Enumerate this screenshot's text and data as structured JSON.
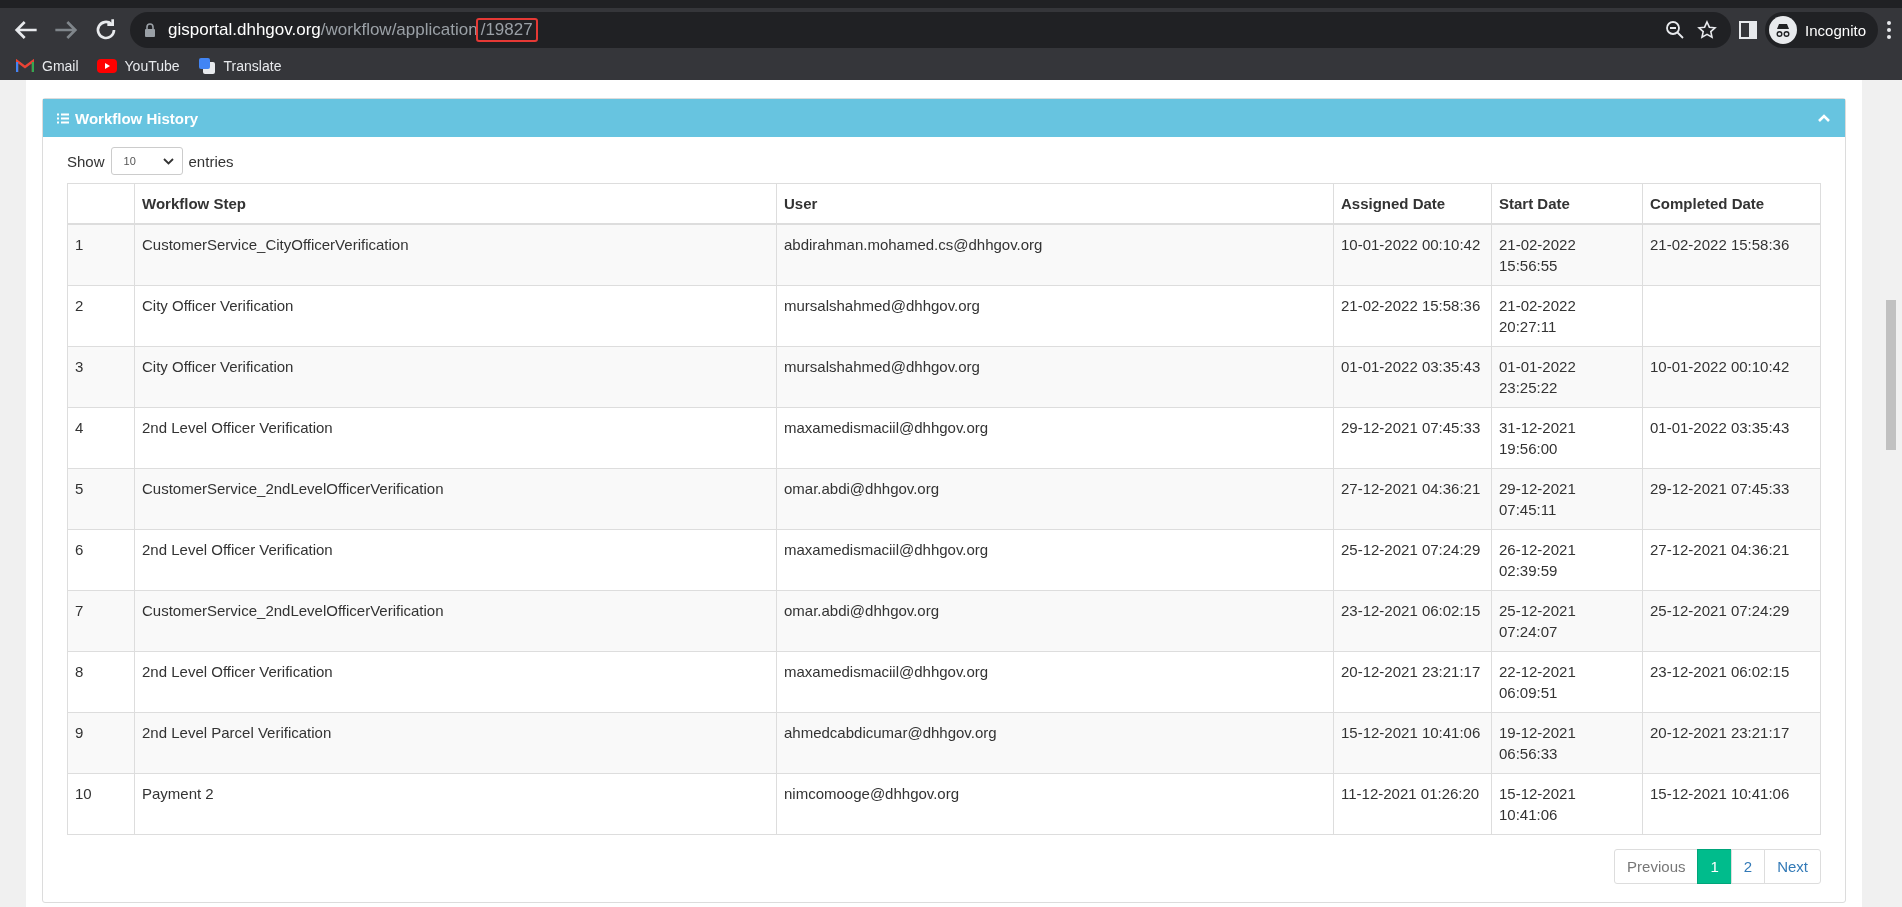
{
  "browser": {
    "address_bar": {
      "host": "gisportal.dhhgov.org",
      "path": "/workflow/application",
      "highlighted": "/19827"
    },
    "profile": "Incognito",
    "bookmarks": [
      {
        "label": "Gmail",
        "kind": "gmail"
      },
      {
        "label": "YouTube",
        "kind": "youtube"
      },
      {
        "label": "Translate",
        "kind": "translate"
      }
    ]
  },
  "panel": {
    "title": "Workflow History",
    "expanded": true,
    "length": {
      "label_before": "Show",
      "value": "10",
      "label_after": "entries"
    },
    "table": {
      "columns": [
        "",
        "Workflow Step",
        "User",
        "Assigned Date",
        "Start Date",
        "Completed Date"
      ],
      "rows": [
        [
          "1",
          "CustomerService_CityOfficerVerification",
          "abdirahman.mohamed.cs@dhhgov.org",
          "10-01-2022 00:10:42",
          "21-02-2022 15:56:55",
          "21-02-2022 15:58:36"
        ],
        [
          "2",
          "City Officer Verification",
          "mursalshahmed@dhhgov.org",
          "21-02-2022 15:58:36",
          "21-02-2022 20:27:11",
          ""
        ],
        [
          "3",
          "City Officer Verification",
          "mursalshahmed@dhhgov.org",
          "01-01-2022 03:35:43",
          "01-01-2022 23:25:22",
          "10-01-2022 00:10:42"
        ],
        [
          "4",
          "2nd Level Officer Verification",
          "maxamedismaciil@dhhgov.org",
          "29-12-2021 07:45:33",
          "31-12-2021 19:56:00",
          "01-01-2022 03:35:43"
        ],
        [
          "5",
          "CustomerService_2ndLevelOfficerVerification",
          "omar.abdi@dhhgov.org",
          "27-12-2021 04:36:21",
          "29-12-2021 07:45:11",
          "29-12-2021 07:45:33"
        ],
        [
          "6",
          "2nd Level Officer Verification",
          "maxamedismaciil@dhhgov.org",
          "25-12-2021 07:24:29",
          "26-12-2021 02:39:59",
          "27-12-2021 04:36:21"
        ],
        [
          "7",
          "CustomerService_2ndLevelOfficerVerification",
          "omar.abdi@dhhgov.org",
          "23-12-2021 06:02:15",
          "25-12-2021 07:24:07",
          "25-12-2021 07:24:29"
        ],
        [
          "8",
          "2nd Level Officer Verification",
          "maxamedismaciil@dhhgov.org",
          "20-12-2021 23:21:17",
          "22-12-2021 06:09:51",
          "23-12-2021 06:02:15"
        ],
        [
          "9",
          "2nd Level Parcel Verification",
          "ahmedcabdicumar@dhhgov.org",
          "15-12-2021 10:41:06",
          "19-12-2021 06:56:33",
          "20-12-2021 23:21:17"
        ],
        [
          "10",
          "Payment 2",
          "nimcomooge@dhhgov.org",
          "11-12-2021 01:26:20",
          "15-12-2021 10:41:06",
          "15-12-2021 10:41:06"
        ]
      ]
    },
    "pagination": {
      "previous": "Previous",
      "pages": [
        {
          "label": "1",
          "selected": true
        },
        {
          "label": "2",
          "selected": false
        }
      ],
      "next": "Next"
    }
  }
}
